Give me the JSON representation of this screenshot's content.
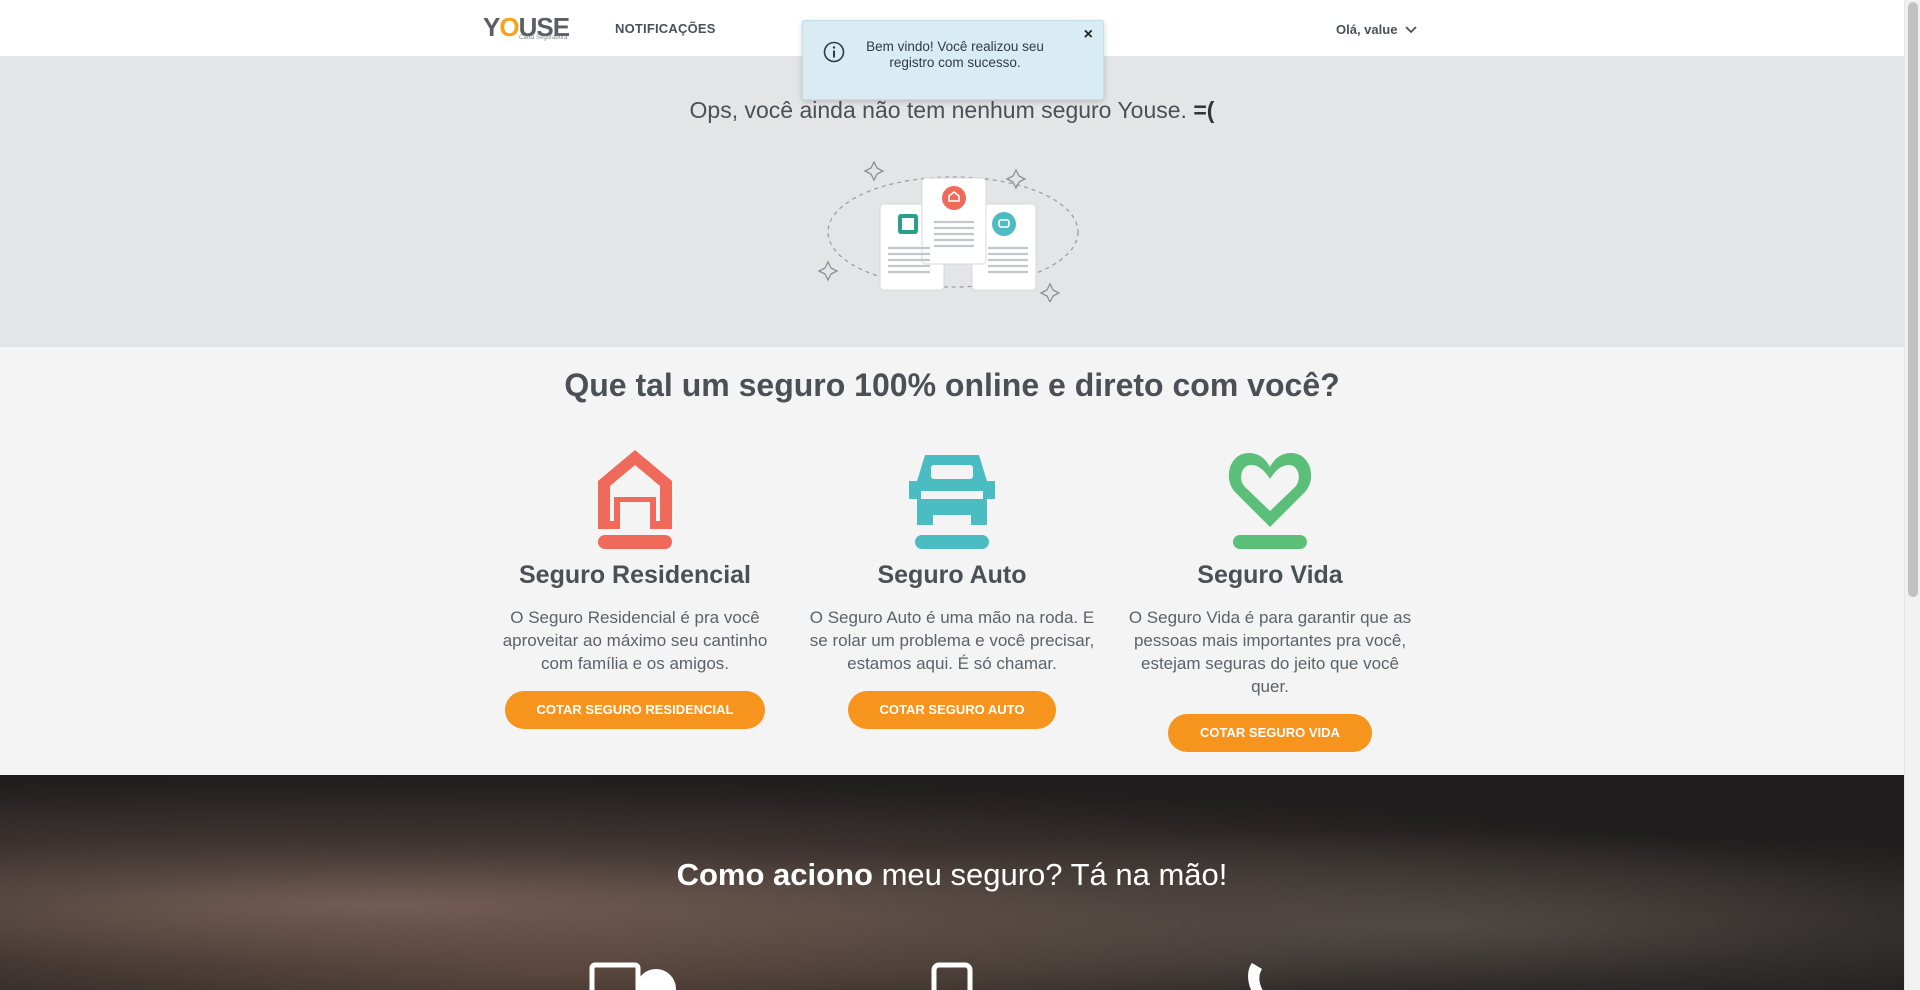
{
  "header": {
    "logo_text": "YOUSE",
    "logo_sub": "Caixa Seguradora",
    "nav_notifications": "NOTIFICAÇÕES",
    "user_greeting": "Olá, value"
  },
  "toast": {
    "message": "Bem vindo! Você realizou seu registro com sucesso.",
    "close_label": "×"
  },
  "empty_state": {
    "message": "Ops, você ainda não tem nenhum seguro Youse.",
    "face": "=("
  },
  "offers": {
    "title": "Que tal um seguro 100% online e direto com você?",
    "cards": [
      {
        "title": "Seguro Residencial",
        "description": "O Seguro Residencial é pra você aproveitar ao máximo seu cantinho com família e os amigos.",
        "button": "COTAR SEGURO RESIDENCIAL",
        "icon": "house-icon",
        "color": "#ef6a5a"
      },
      {
        "title": "Seguro Auto",
        "description": "O Seguro Auto é uma mão na roda. E se rolar um problema e você precisar, estamos aqui. É só chamar.",
        "button": "COTAR SEGURO AUTO",
        "icon": "car-icon",
        "color": "#4cbcc3"
      },
      {
        "title": "Seguro Vida",
        "description": "O Seguro Vida é para garantir que as pessoas mais importantes pra você, estejam seguras do jeito que você quer.",
        "button": "COTAR SEGURO VIDA",
        "icon": "heart-icon",
        "color": "#5bbf7a"
      }
    ]
  },
  "how": {
    "title_bold": "Como aciono",
    "title_rest": " meu seguro? Tá na mão!"
  },
  "colors": {
    "accent": "#f7941d",
    "toast_bg": "#d9ecf3",
    "hero_bg": "#e4e5e7"
  }
}
